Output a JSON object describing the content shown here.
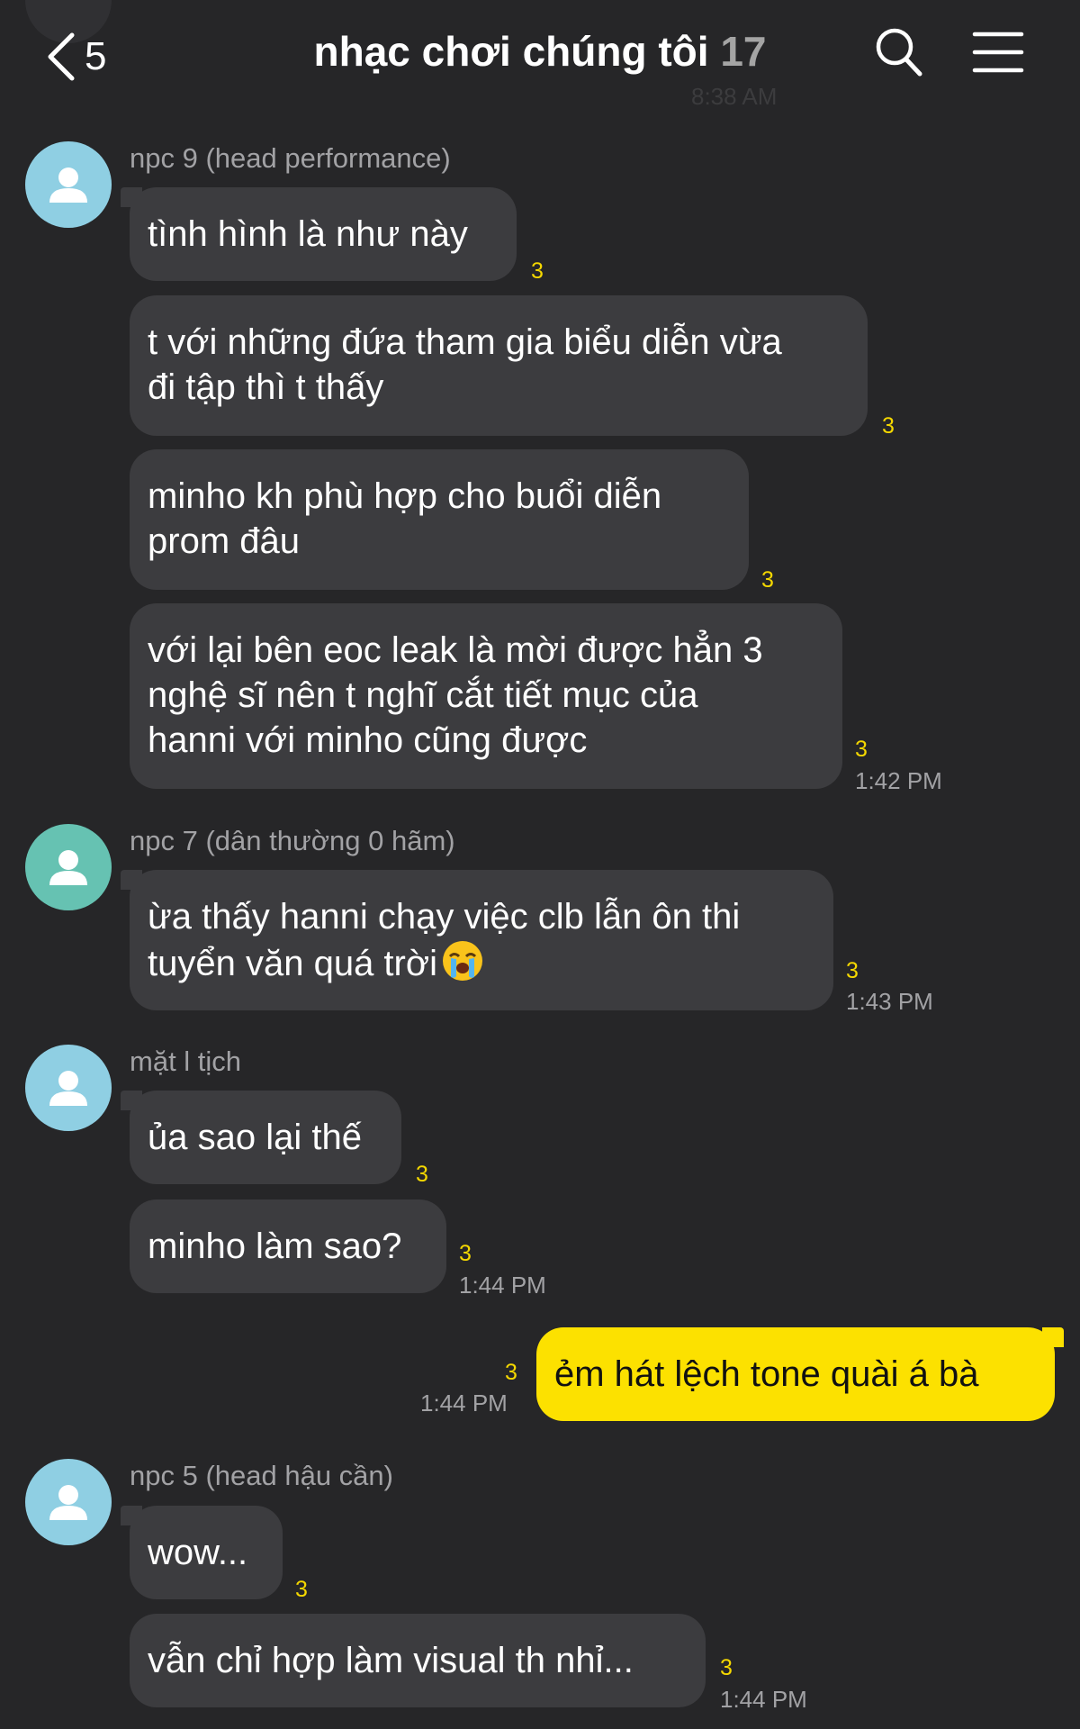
{
  "header": {
    "back_count": "5",
    "title": "nhạc chơi chúng tôi",
    "member_count": "17",
    "ghost_time": "8:38 AM"
  },
  "icons": {
    "back": "chevron-left-icon",
    "search": "search-icon",
    "menu": "hamburger-menu-icon",
    "avatar": "default-person-icon",
    "emoji": "loudly-crying-face-emoji"
  },
  "colors": {
    "background": "#262628",
    "incoming_bubble": "#3c3c3f",
    "outgoing_bubble": "#fce100",
    "unread": "#f5d800",
    "avatar_blue": "#8fcfe3",
    "avatar_teal": "#66c2b2"
  },
  "messages": [
    {
      "sender": "npc 9 (head performance)",
      "avatar_color": "blue",
      "bubbles": [
        {
          "lines": [
            "tình hình là như này"
          ],
          "unread": "3",
          "time": ""
        },
        {
          "lines": [
            "t với những đứa tham gia biểu diễn vừa",
            "đi tập thì t thấy"
          ],
          "unread": "3",
          "time": ""
        },
        {
          "lines": [
            "minho kh phù hợp cho buổi diễn",
            "prom đâu"
          ],
          "unread": "3",
          "time": ""
        },
        {
          "lines": [
            "với lại bên eoc leak là mời được hẳn 3",
            "nghệ sĩ nên t nghĩ cắt tiết mục của",
            "hanni với minho cũng được"
          ],
          "unread": "3",
          "time": "1:42 PM"
        }
      ]
    },
    {
      "sender": "npc 7 (dân thường 0 hãm)",
      "avatar_color": "teal",
      "bubbles": [
        {
          "lines": [
            "ừa thấy hanni chạy việc clb lẫn ôn thi",
            "tuyển văn quá trời"
          ],
          "unread": "3",
          "time": "1:43 PM"
        }
      ]
    },
    {
      "sender": "mặt l tịch",
      "avatar_color": "blue",
      "bubbles": [
        {
          "lines": [
            "ủa sao lại thế"
          ],
          "unread": "3",
          "time": ""
        },
        {
          "lines": [
            "minho làm sao?"
          ],
          "unread": "3",
          "time": "1:44 PM"
        }
      ]
    },
    {
      "sender": "me",
      "bubbles": [
        {
          "lines": [
            "ẻm hát lệch tone quài á bà"
          ],
          "unread": "3",
          "time": "1:44 PM"
        }
      ]
    },
    {
      "sender": "npc 5 (head hậu cần)",
      "avatar_color": "blue",
      "bubbles": [
        {
          "lines": [
            "wow..."
          ],
          "unread": "3",
          "time": ""
        },
        {
          "lines": [
            "vẫn chỉ hợp làm visual th nhỉ..."
          ],
          "unread": "3",
          "time": "1:44 PM"
        }
      ]
    }
  ]
}
